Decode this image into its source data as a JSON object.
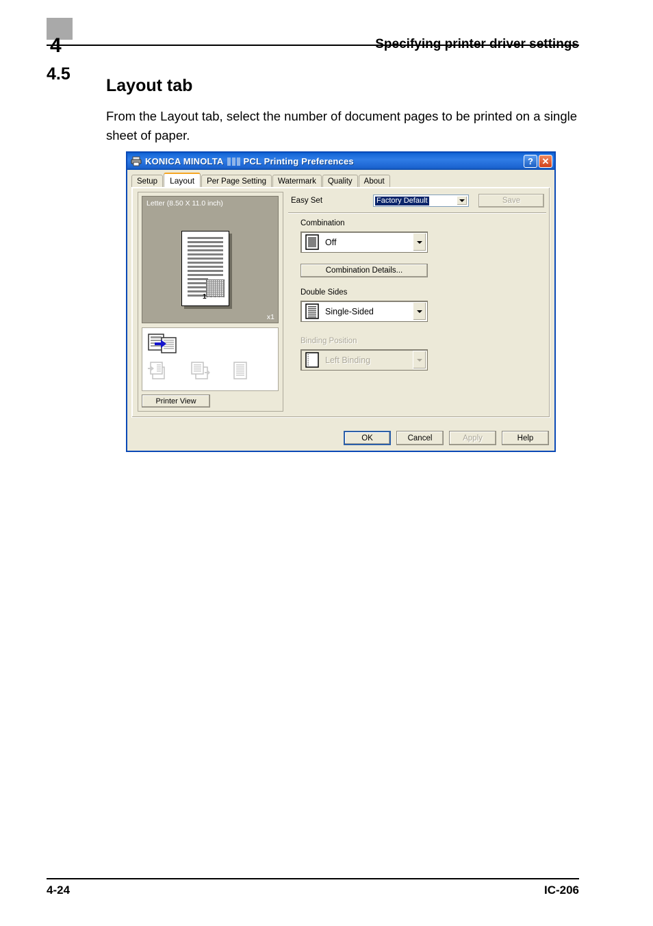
{
  "page": {
    "chapter_number": "4",
    "header_title": "Specifying printer driver settings",
    "section_number": "4.5",
    "section_title": "Layout tab",
    "section_body": "From the Layout tab, select the number of document pages to be printed on a single sheet of paper.",
    "footer_left": "4-24",
    "footer_right": "IC-206"
  },
  "dialog": {
    "title_brand": "KONICA MINOLTA",
    "title_suffix": "PCL Printing Preferences",
    "title_redacted": "███",
    "help_button": "?",
    "close_button": "✕",
    "tabs": [
      {
        "label": "Setup",
        "active": false
      },
      {
        "label": "Layout",
        "active": true
      },
      {
        "label": "Per Page Setting",
        "active": false
      },
      {
        "label": "Watermark",
        "active": false
      },
      {
        "label": "Quality",
        "active": false
      },
      {
        "label": "About",
        "active": false
      }
    ],
    "preview": {
      "paper_label": "Letter (8.50 X 11.0 inch)",
      "scale_label": "x1",
      "page_number": "1"
    },
    "printer_view_button": "Printer View",
    "easy_set": {
      "label": "Easy Set",
      "value": "Factory Default",
      "save_button": "Save",
      "save_disabled": true
    },
    "combination": {
      "label": "Combination",
      "value": "Off",
      "details_button": "Combination Details..."
    },
    "double_sides": {
      "label": "Double Sides",
      "value": "Single-Sided"
    },
    "binding_position": {
      "label": "Binding Position",
      "value": "Left Binding",
      "disabled": true
    },
    "buttons": {
      "ok": "OK",
      "cancel": "Cancel",
      "apply": "Apply",
      "help": "Help",
      "apply_disabled": true
    },
    "colors": {
      "titlebar_blue": "#1b63cf",
      "dialog_face": "#ece9d8",
      "active_tab_accent": "#f5a623",
      "selection_blue": "#0a246a",
      "preview_backdrop": "#a8a495",
      "close_button_red": "#d0401a",
      "arrow_icon_blue": "#1414cd"
    }
  }
}
